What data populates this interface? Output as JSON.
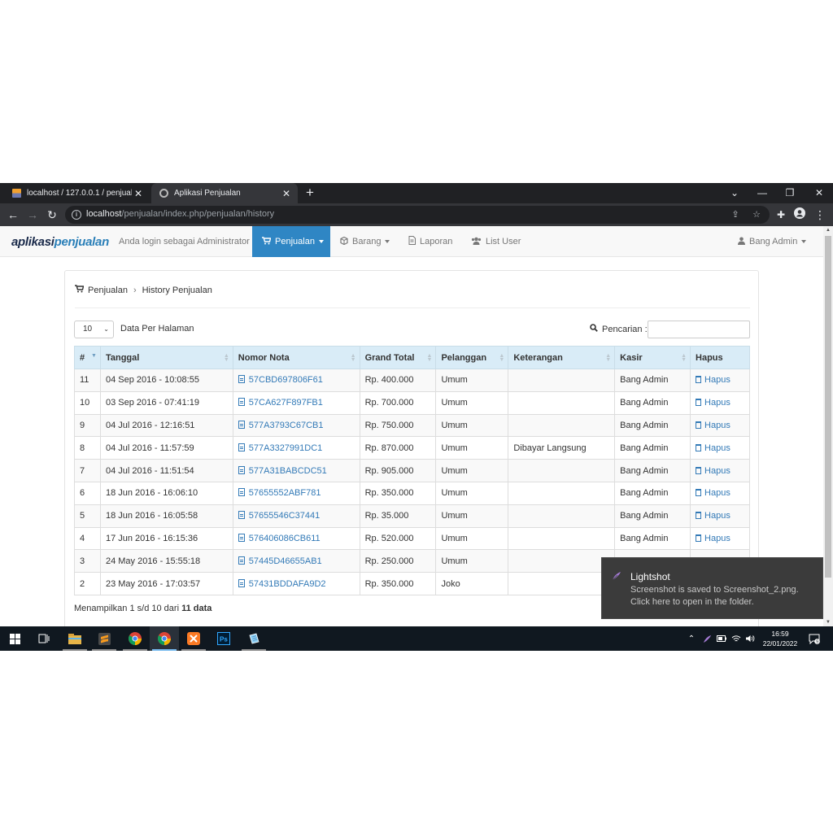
{
  "browser": {
    "tabs": [
      {
        "title": "localhost / 127.0.0.1 / penjualan_",
        "active": false
      },
      {
        "title": "Aplikasi Penjualan",
        "active": true
      }
    ],
    "url_host": "localhost",
    "url_path": "/penjualan/index.php/penjualan/history"
  },
  "app": {
    "brand_part1": "aplikasi",
    "brand_part2": "penjualan",
    "login_text": "Anda login sebagai Administrator",
    "nav": [
      {
        "label": "Penjualan",
        "icon": "cart-icon",
        "active": true,
        "dropdown": true
      },
      {
        "label": "Barang",
        "icon": "cube-icon",
        "active": false,
        "dropdown": true
      },
      {
        "label": "Laporan",
        "icon": "file-icon",
        "active": false,
        "dropdown": false
      },
      {
        "label": "List User",
        "icon": "users-icon",
        "active": false,
        "dropdown": false
      }
    ],
    "user_menu": "Bang Admin",
    "accent_color": "#2f86c4"
  },
  "breadcrumb": {
    "root": "Penjualan",
    "current": "History Penjualan"
  },
  "controls": {
    "per_page_value": "10",
    "per_page_label": "Data Per Halaman",
    "search_label": "Pencarian :",
    "search_value": ""
  },
  "table": {
    "headers": [
      "#",
      "Tanggal",
      "Nomor Nota",
      "Grand Total",
      "Pelanggan",
      "Keterangan",
      "Kasir",
      "Hapus"
    ],
    "rows": [
      {
        "no": "11",
        "tanggal": "04 Sep 2016 - 10:08:55",
        "nota": "57CBD697806F61",
        "total": "Rp. 400.000",
        "pelanggan": "Umum",
        "keterangan": "",
        "kasir": "Bang Admin",
        "hapus": "Hapus"
      },
      {
        "no": "10",
        "tanggal": "03 Sep 2016 - 07:41:19",
        "nota": "57CA627F897FB1",
        "total": "Rp. 700.000",
        "pelanggan": "Umum",
        "keterangan": "",
        "kasir": "Bang Admin",
        "hapus": "Hapus"
      },
      {
        "no": "9",
        "tanggal": "04 Jul 2016 - 12:16:51",
        "nota": "577A3793C67CB1",
        "total": "Rp. 750.000",
        "pelanggan": "Umum",
        "keterangan": "",
        "kasir": "Bang Admin",
        "hapus": "Hapus"
      },
      {
        "no": "8",
        "tanggal": "04 Jul 2016 - 11:57:59",
        "nota": "577A3327991DC1",
        "total": "Rp. 870.000",
        "pelanggan": "Umum",
        "keterangan": "Dibayar Langsung",
        "kasir": "Bang Admin",
        "hapus": "Hapus"
      },
      {
        "no": "7",
        "tanggal": "04 Jul 2016 - 11:51:54",
        "nota": "577A31BABCDC51",
        "total": "Rp. 905.000",
        "pelanggan": "Umum",
        "keterangan": "",
        "kasir": "Bang Admin",
        "hapus": "Hapus"
      },
      {
        "no": "6",
        "tanggal": "18 Jun 2016 - 16:06:10",
        "nota": "57655552ABF781",
        "total": "Rp. 350.000",
        "pelanggan": "Umum",
        "keterangan": "",
        "kasir": "Bang Admin",
        "hapus": "Hapus"
      },
      {
        "no": "5",
        "tanggal": "18 Jun 2016 - 16:05:58",
        "nota": "57655546C37441",
        "total": "Rp. 35.000",
        "pelanggan": "Umum",
        "keterangan": "",
        "kasir": "Bang Admin",
        "hapus": "Hapus"
      },
      {
        "no": "4",
        "tanggal": "17 Jun 2016 - 16:15:36",
        "nota": "576406086CB611",
        "total": "Rp. 520.000",
        "pelanggan": "Umum",
        "keterangan": "",
        "kasir": "Bang Admin",
        "hapus": "Hapus"
      },
      {
        "no": "3",
        "tanggal": "24 May 2016 - 15:55:18",
        "nota": "57445D46655AB1",
        "total": "Rp. 250.000",
        "pelanggan": "Umum",
        "keterangan": "",
        "kasir": "",
        "hapus": ""
      },
      {
        "no": "2",
        "tanggal": "23 May 2016 - 17:03:57",
        "nota": "57431BDDAFA9D2",
        "total": "Rp. 350.000",
        "pelanggan": "Joko",
        "keterangan": "",
        "kasir": "",
        "hapus": ""
      }
    ]
  },
  "summary": {
    "prefix": "Menampilkan 1 s/d 10 dari",
    "count": "11 data"
  },
  "toast": {
    "title": "Lightshot",
    "line1": "Screenshot is saved to Screenshot_2.png.",
    "line2": "Click here to open in the folder."
  },
  "taskbar": {
    "time": "16:59",
    "date": "22/01/2022",
    "notification_count": "9"
  }
}
